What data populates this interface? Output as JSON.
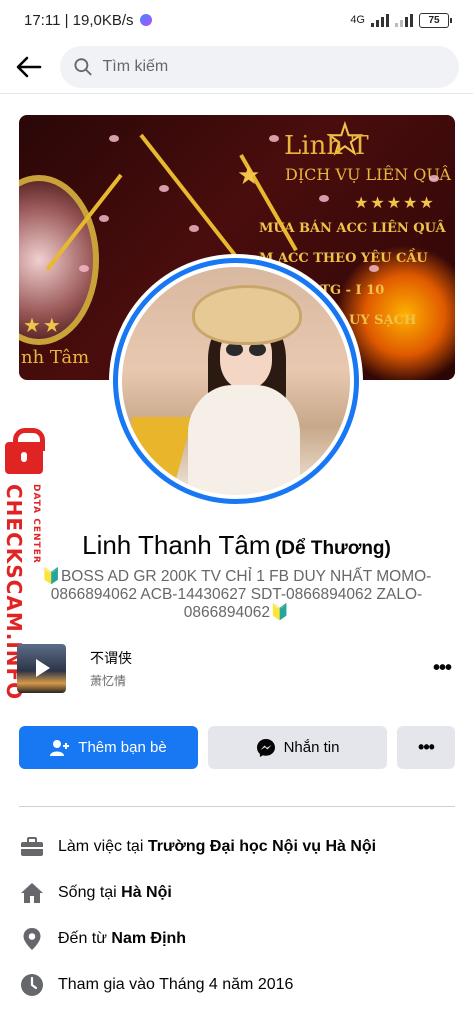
{
  "status_bar": {
    "time_speed": "17:11 | 19,0KB/s",
    "network": "4G",
    "battery": "75"
  },
  "header": {
    "search_placeholder": "Tìm kiếm"
  },
  "cover": {
    "title": "Linh T",
    "subtitle": "DỊCH VỤ LIÊN QUÂ",
    "lines": [
      "MUA BÁN ACC LIÊN QUÂ",
      "M ACC THEO YÊU CẦU",
      "OTG - I 10",
      "UY SẠCH"
    ],
    "name_fragment": "nh Tâm",
    "stars": "★★★★★",
    "colors": {
      "background": "#3a0909",
      "gold": "#e8b92e"
    }
  },
  "profile": {
    "name": "Linh Thanh Tâm",
    "alternate_name": "(Dể Thương)",
    "bio": "🔰BOSS AD GR 200K TV CHỈ 1 FB DUY NHẤT MOMO-0866894062 ACB-14430627 SDT-0866894062 ZALO-0866894062🔰"
  },
  "music": {
    "title": "不谓侠",
    "artist": "萧忆情"
  },
  "actions": {
    "add_friend": "Thêm bạn bè",
    "message": "Nhắn tin",
    "more": "•••"
  },
  "details": [
    {
      "icon": "briefcase-icon",
      "prefix": "Làm việc tại ",
      "value": "Trường Đại học Nội vụ Hà Nội"
    },
    {
      "icon": "home-icon",
      "prefix": "Sống tại ",
      "value": "Hà Nội"
    },
    {
      "icon": "location-pin-icon",
      "prefix": "Đến từ ",
      "value": "Nam Định"
    },
    {
      "icon": "clock-icon",
      "prefix": "Tham gia vào Tháng 4 năm 2016",
      "value": ""
    }
  ],
  "watermark": {
    "text": "CHECKSCAM.INFO",
    "small": "DATA CENTER"
  },
  "colors": {
    "accent": "#1877f2",
    "secondary_button": "#e4e6eb",
    "muted_text": "#65676b",
    "watermark": "#e02424"
  }
}
